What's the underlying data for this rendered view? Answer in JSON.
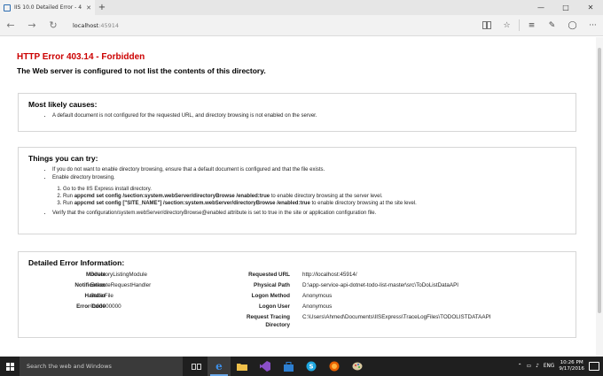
{
  "browser": {
    "tab_title": "IIS 10.0 Detailed Error - 4",
    "tab_close": "✕",
    "new_tab": "+",
    "address_host": "localhost",
    "address_port": ":45914"
  },
  "page": {
    "error_title": "HTTP Error 403.14 - Forbidden",
    "error_subtitle": "The Web server is configured to not list the contents of this directory."
  },
  "causes": {
    "heading": "Most likely causes:",
    "items": [
      "A default document is not configured for the requested URL, and directory browsing is not enabled on the server."
    ]
  },
  "try": {
    "heading": "Things you can try:",
    "item1": "If you do not want to enable directory browsing, ensure that a default document is configured and that the file exists.",
    "item2": "Enable directory browsing.",
    "steps": {
      "s1": "Go to the IIS Express install directory.",
      "s2_prefix": "Run ",
      "s2_cmd": "appcmd set config /section:system.webServer/directoryBrowse /enabled:true",
      "s2_suffix": " to enable directory browsing at the server level.",
      "s3_prefix": "Run ",
      "s3_cmd": "appcmd set config [\"SITE_NAME\"] /section:system.webServer/directoryBrowse /enabled:true",
      "s3_suffix": " to enable directory browsing at the site level."
    },
    "item3": "Verify that the configuration/system.webServer/directoryBrowse@enabled attribute is set to true in the site or application configuration file."
  },
  "details": {
    "heading": "Detailed Error Information:",
    "left": [
      {
        "label": "Module",
        "value": "DirectoryListingModule"
      },
      {
        "label": "Notification",
        "value": "ExecuteRequestHandler"
      },
      {
        "label": "Handler",
        "value": "StaticFile"
      },
      {
        "label": "Error Code",
        "value": "0x00000000"
      }
    ],
    "right": [
      {
        "label": "Requested URL",
        "value": "http://localhost:45914/"
      },
      {
        "label": "Physical Path",
        "value": "D:\\app-service-api-dotnet-todo-list-master\\src\\ToDoListDataAPI"
      },
      {
        "label": "Logon Method",
        "value": "Anonymous"
      },
      {
        "label": "Logon User",
        "value": "Anonymous"
      },
      {
        "label": "Request Tracing",
        "label2": "Directory",
        "value": "C:\\Users\\Ahmed\\Documents\\IISExpress\\TraceLogFiles\\TODOLISTDATAAPI"
      }
    ]
  },
  "taskbar": {
    "search_placeholder": "Search the web and Windows",
    "language": "ENG",
    "time": "10:26 PM",
    "date": "9/17/2016"
  },
  "colors": {
    "error_red": "#cc0000",
    "taskbar": "#1f1f1f",
    "accent": "#6aa8e8"
  }
}
